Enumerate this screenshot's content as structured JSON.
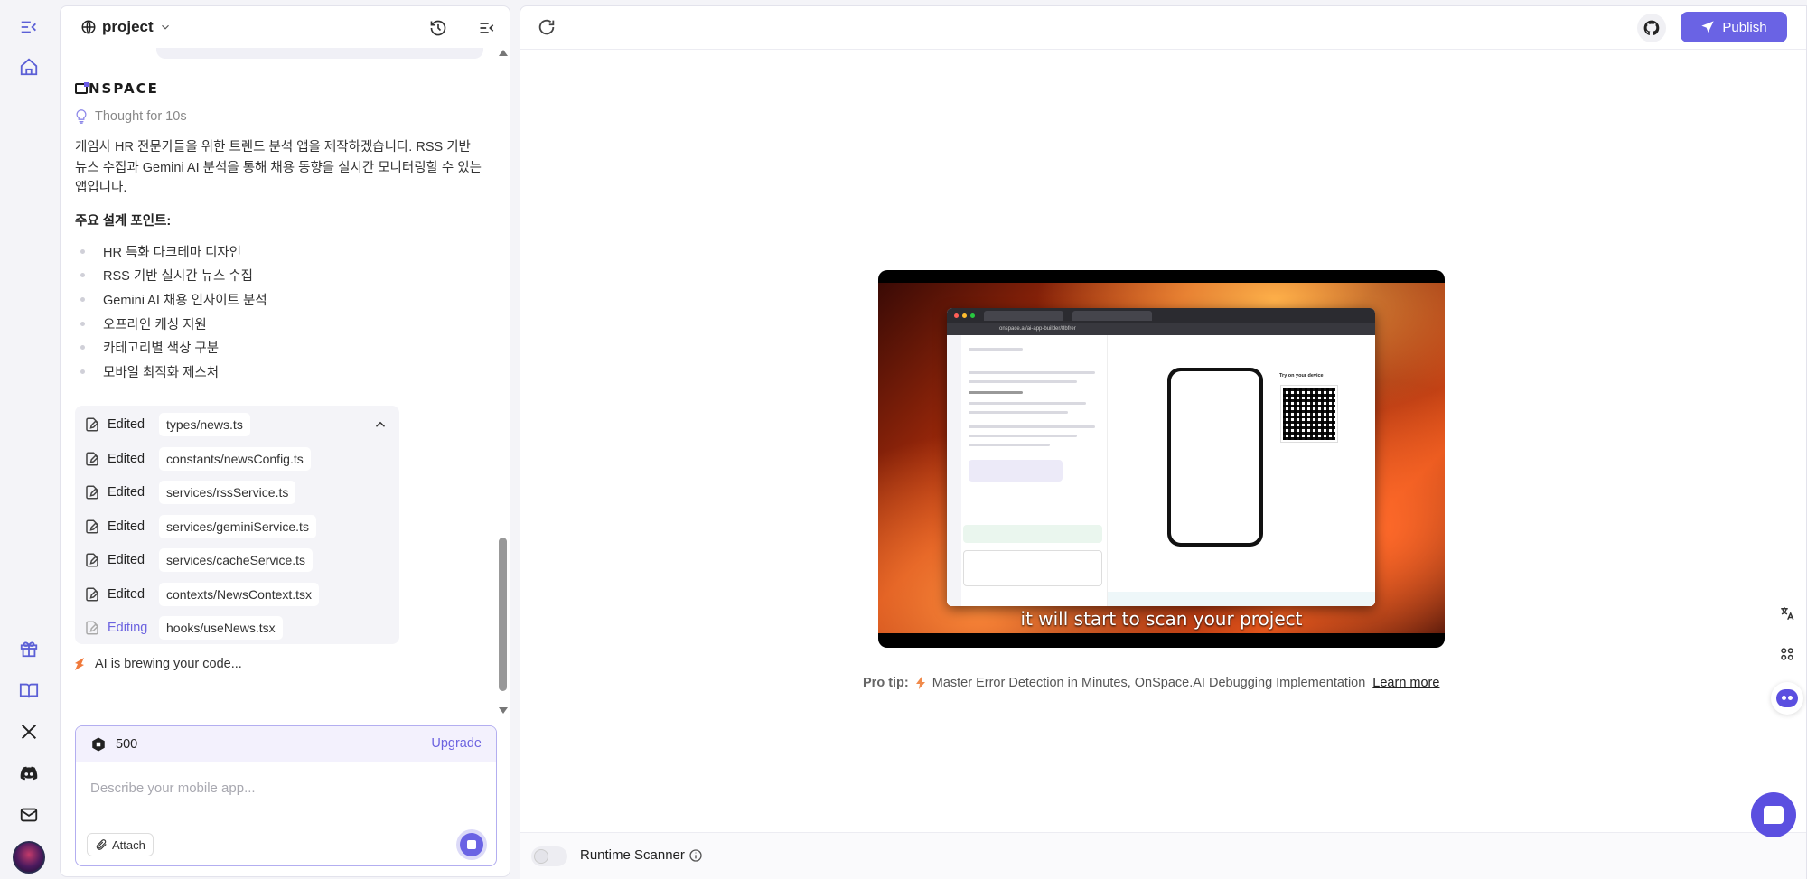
{
  "project": {
    "title": "project"
  },
  "chat": {
    "brand": "NSPACE",
    "thought_label": "Thought for 10s",
    "intro": "게임사 HR 전문가들을 위한 트렌드 분석 앱을 제작하겠습니다. RSS 기반 뉴스 수집과 Gemini AI 분석을 통해 채용 동향을 실시간 모니터링할 수 있는 앱입니다.",
    "design_points_title": "주요 설계 포인트:",
    "design_points": [
      "HR 특화 다크테마 디자인",
      "RSS 기반 실시간 뉴스 수집",
      "Gemini AI 채용 인사이트 분석",
      "오프라인 캐싱 지원",
      "카테고리별 색상 구분",
      "모바일 최적화 제스처"
    ],
    "edits": [
      {
        "verb": "Edited",
        "file": "types/news.ts"
      },
      {
        "verb": "Edited",
        "file": "constants/newsConfig.ts"
      },
      {
        "verb": "Edited",
        "file": "services/rssService.ts"
      },
      {
        "verb": "Edited",
        "file": "services/geminiService.ts"
      },
      {
        "verb": "Edited",
        "file": "services/cacheService.ts"
      },
      {
        "verb": "Edited",
        "file": "contexts/NewsContext.tsx"
      },
      {
        "verb": "Editing",
        "file": "hooks/useNews.tsx"
      }
    ],
    "status": "AI is brewing your code..."
  },
  "composer": {
    "credits": "500",
    "upgrade_label": "Upgrade",
    "placeholder": "Describe your mobile app...",
    "attach_label": "Attach"
  },
  "preview": {
    "publish_label": "Publish",
    "video_caption": "it will start to scan your project",
    "video_url": "onspace.ai/ai-app-builder/8bfrer",
    "video_try_label": "Try on your device",
    "pro_tip_label": "Pro tip:",
    "pro_tip_text": "Master Error Detection in Minutes, OnSpace.AI Debugging Implementation",
    "learn_more": "Learn more",
    "runtime_scanner_label": "Runtime Scanner"
  },
  "colors": {
    "accent": "#6a63e4",
    "active_edit": "#6c63e0"
  }
}
